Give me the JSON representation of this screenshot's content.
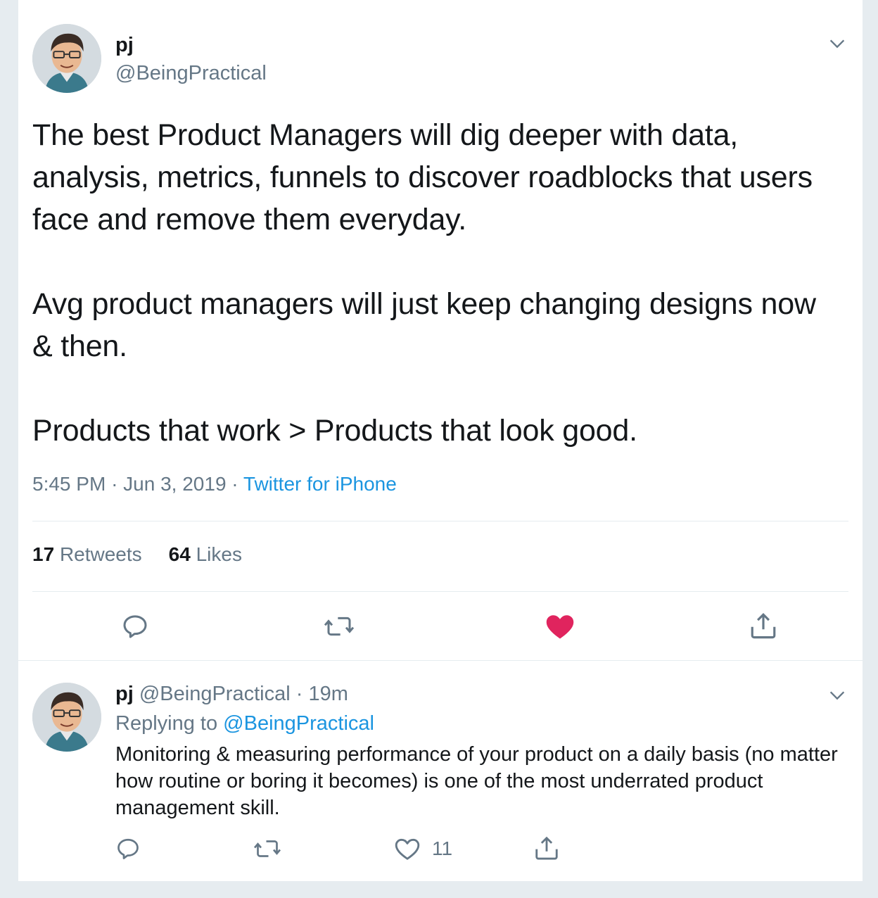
{
  "main_tweet": {
    "author_name": "pj",
    "author_handle": "@BeingPractical",
    "paragraphs": [
      "The best Product Managers will dig deeper with data, analysis, metrics, funnels to discover roadblocks that users face and remove them everyday.",
      "Avg product managers will just keep changing designs now & then.",
      "Products that work > Products that look good."
    ],
    "time": "5:45 PM",
    "date": "Jun 3, 2019",
    "source": "Twitter for iPhone",
    "separator": "·",
    "retweets_count": "17",
    "retweets_label": "Retweets",
    "likes_count": "64",
    "likes_label": "Likes",
    "actions": [
      "reply-icon",
      "retweet-icon",
      "like-icon-filled",
      "share-icon"
    ],
    "like_color": "#e0245e"
  },
  "reply_tweet": {
    "author_name": "pj",
    "author_handle": "@BeingPractical",
    "separator": "·",
    "age": "19m",
    "replying_prefix": "Replying to",
    "replying_to": "@BeingPractical",
    "text": "Monitoring & measuring performance of your product on a daily basis (no matter how routine or boring it becomes) is one of the most underrated product management skill.",
    "like_count": "11",
    "actions": [
      "reply-icon",
      "retweet-icon",
      "like-icon",
      "share-icon"
    ]
  },
  "colors": {
    "link": "#1b95e0",
    "secondary_text": "#657786",
    "primary_text": "#14171a",
    "background": "#e6ecf0"
  }
}
